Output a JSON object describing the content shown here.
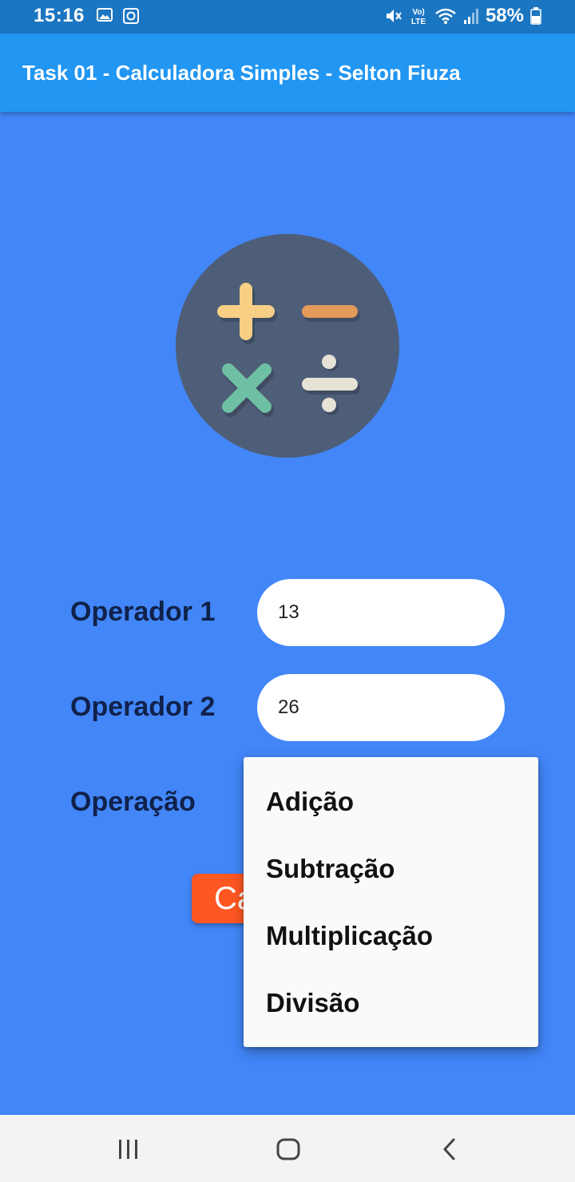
{
  "status_bar": {
    "time": "15:16",
    "battery": "58%",
    "icons": [
      "image-icon",
      "sync-icon",
      "mute-icon",
      "volte-icon",
      "wifi-icon",
      "signal-icon",
      "battery-icon"
    ]
  },
  "app_bar": {
    "title": "Task 01 - Calculadora Simples - Selton Fiuza"
  },
  "logo": {
    "icon": "calculator-operations-icon",
    "colors": {
      "circle": "#4e5e78",
      "plus": "#f7cf85",
      "minus": "#e39a5a",
      "times": "#6fbfa4",
      "divide": "#e6e2d6"
    }
  },
  "form": {
    "operador1": {
      "label": "Operador 1",
      "value": "13"
    },
    "operador2": {
      "label": "Operador 2",
      "value": "26"
    },
    "operacao": {
      "label": "Operação"
    },
    "button_label": "Calcular"
  },
  "dropdown": {
    "options": [
      "Adição",
      "Subtração",
      "Multiplicação",
      "Divisão"
    ]
  },
  "nav_bar": {
    "icons": [
      "recents-icon",
      "home-icon",
      "back-icon"
    ]
  },
  "colors": {
    "background": "#4286f8",
    "app_bar": "#2196f3",
    "status_bar": "#1b76c2",
    "button": "#ff5722",
    "label": "#10214a"
  }
}
